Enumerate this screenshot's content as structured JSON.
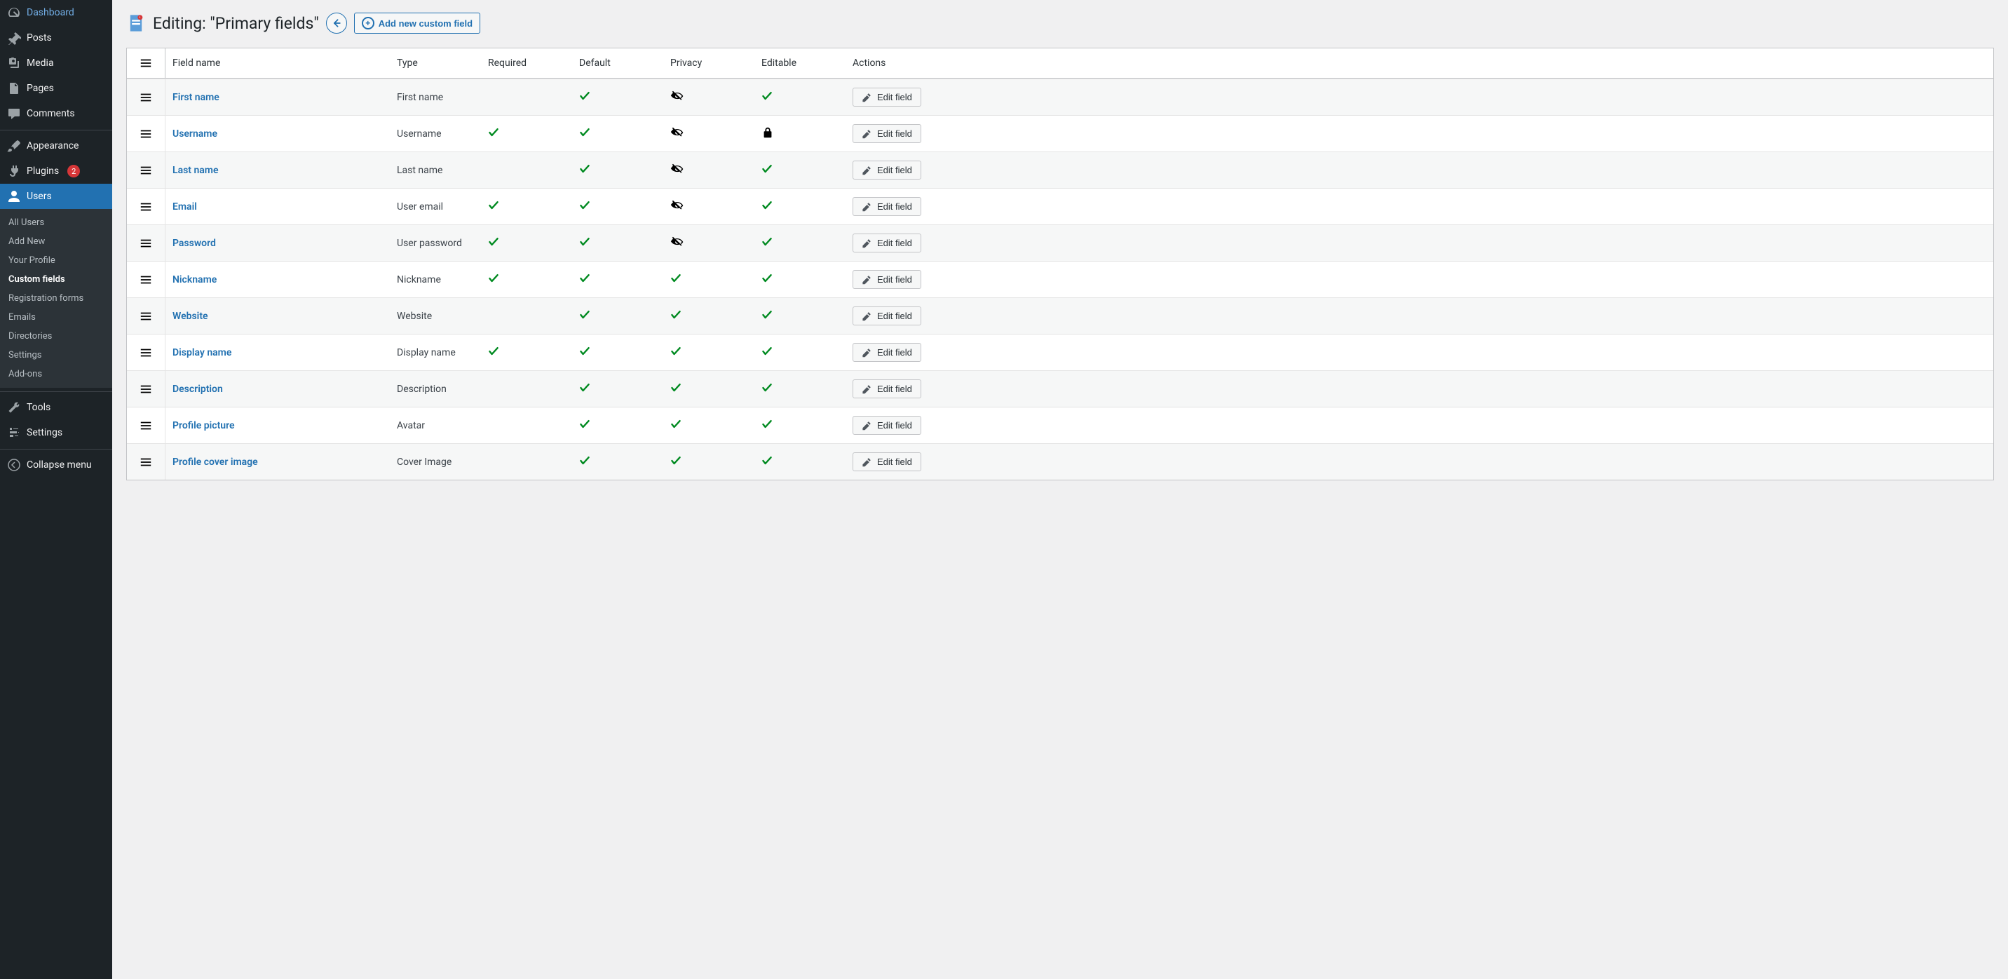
{
  "sidebar": {
    "main_items": [
      {
        "id": "dashboard",
        "label": "Dashboard",
        "icon": "dashboard"
      },
      {
        "id": "posts",
        "label": "Posts",
        "icon": "pin"
      },
      {
        "id": "media",
        "label": "Media",
        "icon": "media"
      },
      {
        "id": "pages",
        "label": "Pages",
        "icon": "pages"
      },
      {
        "id": "comments",
        "label": "Comments",
        "icon": "comment"
      },
      {
        "id": "appearance",
        "label": "Appearance",
        "icon": "brush",
        "sepBefore": true
      },
      {
        "id": "plugins",
        "label": "Plugins",
        "icon": "plug",
        "badge": "2"
      },
      {
        "id": "users",
        "label": "Users",
        "icon": "user",
        "current": true,
        "submenu": [
          {
            "id": "all-users",
            "label": "All Users"
          },
          {
            "id": "add-new",
            "label": "Add New"
          },
          {
            "id": "your-profile",
            "label": "Your Profile"
          },
          {
            "id": "custom-fields",
            "label": "Custom fields",
            "current": true
          },
          {
            "id": "reg-forms",
            "label": "Registration forms"
          },
          {
            "id": "emails",
            "label": "Emails"
          },
          {
            "id": "directories",
            "label": "Directories"
          },
          {
            "id": "settings",
            "label": "Settings"
          },
          {
            "id": "addons",
            "label": "Add-ons"
          }
        ]
      },
      {
        "id": "tools",
        "label": "Tools",
        "icon": "wrench",
        "sepBefore": true
      },
      {
        "id": "settings",
        "label": "Settings",
        "icon": "sliders"
      }
    ],
    "collapse_label": "Collapse menu"
  },
  "header": {
    "title": "Editing: \"Primary fields\"",
    "add_button": "Add new custom field"
  },
  "table": {
    "columns": [
      "Field name",
      "Type",
      "Required",
      "Default",
      "Privacy",
      "Editable",
      "Actions"
    ],
    "edit_label": "Edit field",
    "rows": [
      {
        "name": "First name",
        "type": "First name",
        "required": false,
        "default": true,
        "privacy": "hidden",
        "editable": "check"
      },
      {
        "name": "Username",
        "type": "Username",
        "required": true,
        "default": true,
        "privacy": "hidden",
        "editable": "locked"
      },
      {
        "name": "Last name",
        "type": "Last name",
        "required": false,
        "default": true,
        "privacy": "hidden",
        "editable": "check"
      },
      {
        "name": "Email",
        "type": "User email",
        "required": true,
        "default": true,
        "privacy": "hidden",
        "editable": "check"
      },
      {
        "name": "Password",
        "type": "User password",
        "required": true,
        "default": true,
        "privacy": "hidden",
        "editable": "check"
      },
      {
        "name": "Nickname",
        "type": "Nickname",
        "required": true,
        "default": true,
        "privacy": "check",
        "editable": "check"
      },
      {
        "name": "Website",
        "type": "Website",
        "required": false,
        "default": true,
        "privacy": "check",
        "editable": "check"
      },
      {
        "name": "Display name",
        "type": "Display name",
        "required": true,
        "default": true,
        "privacy": "check",
        "editable": "check"
      },
      {
        "name": "Description",
        "type": "Description",
        "required": false,
        "default": true,
        "privacy": "check",
        "editable": "check"
      },
      {
        "name": "Profile picture",
        "type": "Avatar",
        "required": false,
        "default": true,
        "privacy": "check",
        "editable": "check"
      },
      {
        "name": "Profile cover image",
        "type": "Cover Image",
        "required": false,
        "default": true,
        "privacy": "check",
        "editable": "check"
      }
    ]
  }
}
